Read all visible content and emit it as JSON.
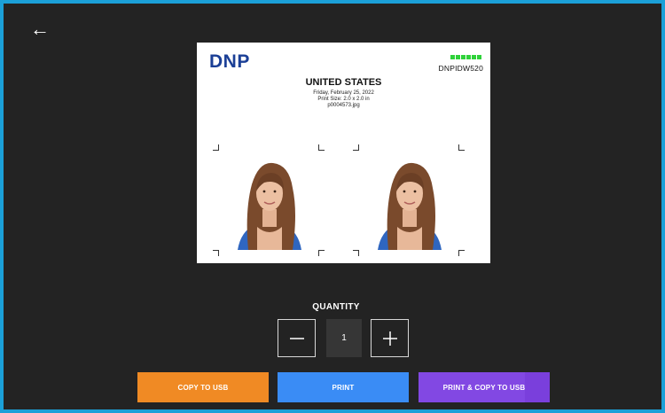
{
  "nav": {
    "back_icon": "left-arrow-icon",
    "back_glyph": "←"
  },
  "preview": {
    "brand": "DNP",
    "model": "DNPIDW520",
    "country": "UNITED STATES",
    "date": "Friday, February 25, 2022",
    "print_size": "Print Size: 2.0 x 2.0 in",
    "filename": "p0004573.jpg",
    "status_color": "#2fd23a",
    "photo_count": 2
  },
  "quantity": {
    "label": "QUANTITY",
    "value": "1",
    "decrement_glyph": "−",
    "increment_glyph": "+"
  },
  "actions": {
    "copy_to_usb": "COPY TO USB",
    "print": "PRINT",
    "print_and_copy": "PRINT & COPY TO USB"
  },
  "colors": {
    "frame": "#1ba0d8",
    "copy": "#f08a24",
    "print": "#3a8cf5",
    "print_and_copy": "#8248e3"
  }
}
